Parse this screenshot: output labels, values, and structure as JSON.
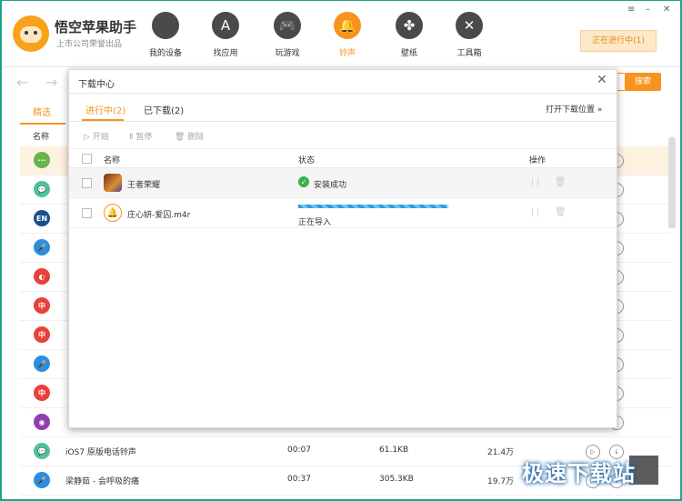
{
  "app": {
    "title": "悟空苹果助手",
    "subtitle": "上市公司荣誉出品",
    "logo_icon": "monkey-logo-icon"
  },
  "nav": [
    {
      "label": "我的设备",
      "icon": "apple-icon",
      "glyph": ""
    },
    {
      "label": "找应用",
      "icon": "appstore-icon",
      "glyph": "A"
    },
    {
      "label": "玩游戏",
      "icon": "gamepad-icon",
      "glyph": "🎮"
    },
    {
      "label": "铃声",
      "icon": "bell-icon",
      "glyph": "🔔",
      "active": true
    },
    {
      "label": "壁纸",
      "icon": "clover-icon",
      "glyph": "✤"
    },
    {
      "label": "工具箱",
      "icon": "tools-icon",
      "glyph": "✕"
    }
  ],
  "window_controls": {
    "menu": "≡",
    "minimize": "–",
    "close": "✕"
  },
  "progress_button": "正在进行中(1)",
  "search_button": "搜索",
  "background": {
    "tab": "精选",
    "col_name": "名称",
    "rows": [
      {
        "icon_color": "#69b34c",
        "glyph": "···"
      },
      {
        "icon_color": "#4dc3a0",
        "glyph": "💬"
      },
      {
        "icon_color": "#1a4f8f",
        "glyph": "EN"
      },
      {
        "icon_color": "#2d8de0",
        "glyph": "🎤"
      },
      {
        "icon_color": "#e8403a",
        "glyph": "◐"
      },
      {
        "icon_color": "#e8403a",
        "glyph": "中"
      },
      {
        "icon_color": "#e8403a",
        "glyph": "中"
      },
      {
        "icon_color": "#2d8de0",
        "glyph": "🎤"
      },
      {
        "icon_color": "#e8403a",
        "glyph": "中"
      },
      {
        "icon_color": "#8e3fae",
        "glyph": "◉"
      },
      {
        "icon_color": "#4dc3a0",
        "glyph": "💬",
        "name": "iOS7 原版电话铃声",
        "duration": "00:07",
        "size": "61.1KB",
        "count": "21.4万"
      },
      {
        "icon_color": "#2d8de0",
        "glyph": "🎤",
        "name": "梁静茹 - 会呼吸的痛",
        "duration": "00:37",
        "size": "305.3KB",
        "count": "19.7万"
      }
    ]
  },
  "modal": {
    "title": "下载中心",
    "close": "✕",
    "tabs": [
      {
        "label": "进行中(2)",
        "active": true
      },
      {
        "label": "已下载(2)",
        "active": false
      }
    ],
    "open_location": "打开下载位置 »",
    "tools": [
      {
        "label": "▷ 开始"
      },
      {
        "label": "Ⅱ 暂停"
      },
      {
        "label": "🗑 删除"
      }
    ],
    "headers": {
      "name": "名称",
      "status": "状态",
      "ops": "操作"
    },
    "rows": [
      {
        "name": "王者荣耀",
        "status": "安装成功",
        "status_icon": "check-icon"
      },
      {
        "name": "庄心妍-爱囚.m4r",
        "status": "正在导入",
        "progress": 0.99
      }
    ],
    "op_pause": "| |",
    "op_delete": "🗑"
  },
  "watermark": "极速下载站"
}
